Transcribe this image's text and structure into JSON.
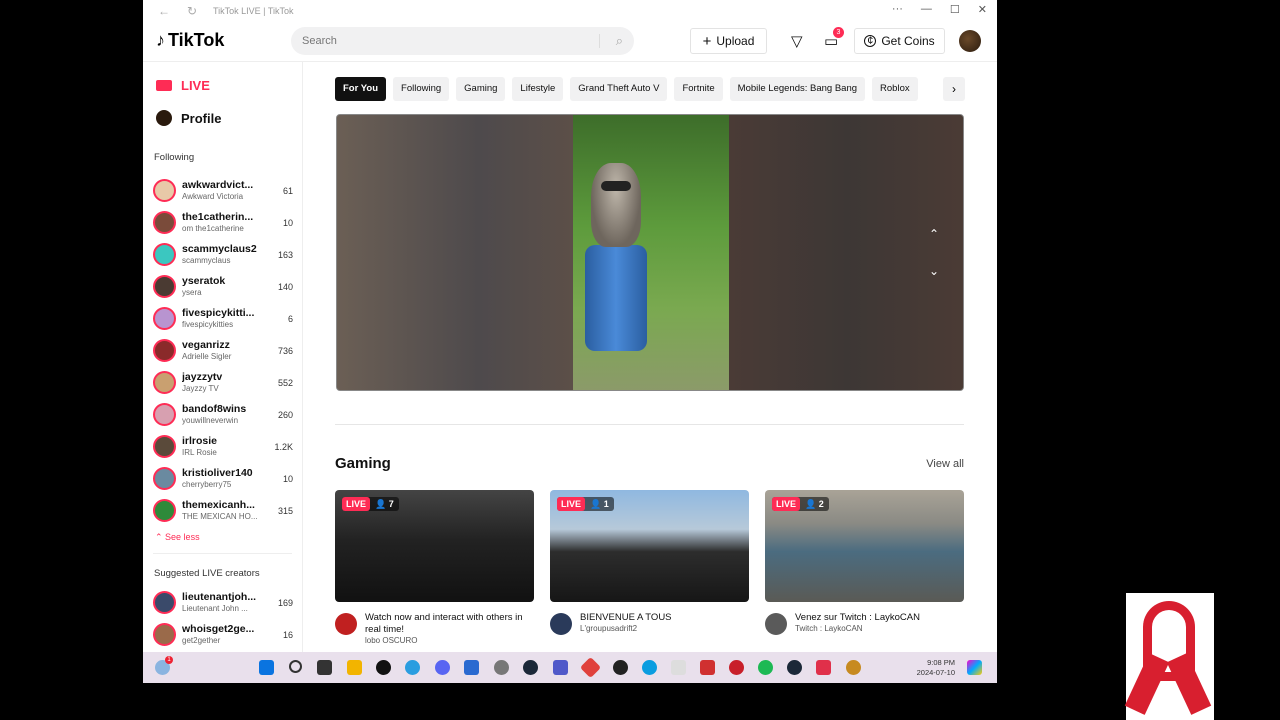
{
  "window": {
    "title": "TikTok LIVE | TikTok"
  },
  "header": {
    "logo": "TikTok",
    "search_placeholder": "Search",
    "upload_label": "Upload",
    "inbox_badge": "3",
    "coins_label": "Get Coins"
  },
  "sidebar": {
    "live_label": "LIVE",
    "profile_label": "Profile",
    "following_title": "Following",
    "following": [
      {
        "name": "awkwardvict...",
        "sub": "Awkward Victoria",
        "count": "61",
        "color": "#e8c9a8"
      },
      {
        "name": "the1catherin...",
        "sub": "om the1catherine",
        "count": "10",
        "color": "#7a4b3a"
      },
      {
        "name": "scammyclaus2",
        "sub": "scammyclaus",
        "count": "163",
        "color": "#3bc7c0"
      },
      {
        "name": "yseratok",
        "sub": "ysera",
        "count": "140",
        "color": "#4a3a32"
      },
      {
        "name": "fivespicykitti...",
        "sub": "fivespicykitties",
        "count": "6",
        "color": "#b894d0"
      },
      {
        "name": "veganrizz",
        "sub": "Adrielle Sigler",
        "count": "736",
        "color": "#8a2a2a"
      },
      {
        "name": "jayzzytv",
        "sub": "Jayzzy TV",
        "count": "552",
        "color": "#c9a070"
      },
      {
        "name": "bandof8wins",
        "sub": "youwillneverwin",
        "count": "260",
        "color": "#d7a0b0"
      },
      {
        "name": "irlrosie",
        "sub": "IRL Rosie",
        "count": "1.2K",
        "color": "#5a4a3a"
      },
      {
        "name": "kristioliver140",
        "sub": "cherryberry75",
        "count": "10",
        "color": "#6a8aa0"
      },
      {
        "name": "themexicanh...",
        "sub": "THE MEXICAN HO...",
        "count": "315",
        "color": "#2e8a3a"
      }
    ],
    "see_less": "See less",
    "suggested_title": "Suggested LIVE creators",
    "suggested": [
      {
        "name": "lieutenantjoh...",
        "sub": "Lieutenant John ...",
        "count": "169",
        "color": "#3a4a6a"
      },
      {
        "name": "whoisget2ge...",
        "sub": "get2gether",
        "count": "16",
        "color": "#9a6a4a"
      }
    ]
  },
  "main": {
    "chips": [
      "For You",
      "Following",
      "Gaming",
      "Lifestyle",
      "Grand Theft Auto V",
      "Fortnite",
      "Mobile Legends: Bang Bang",
      "Roblox"
    ],
    "section_title": "Gaming",
    "view_all": "View all",
    "cards": [
      {
        "live": "LIVE",
        "viewers": "7",
        "title": "Watch now and interact with others in real time!",
        "sub": "lobo OSCURO",
        "avatar_color": "#c02020"
      },
      {
        "live": "LIVE",
        "viewers": "1",
        "title": "BIENVENUE A TOUS",
        "sub": "L'groupusadrift2",
        "avatar_color": "#2a3a5a"
      },
      {
        "live": "LIVE",
        "viewers": "2",
        "title": "Venez sur Twitch : LaykoCAN",
        "sub": "Twitch : LaykoCAN",
        "avatar_color": "#5a5a5a"
      }
    ]
  },
  "taskbar": {
    "time": "9:08 PM",
    "date": "2024-07-10",
    "weather_badge": "1"
  }
}
